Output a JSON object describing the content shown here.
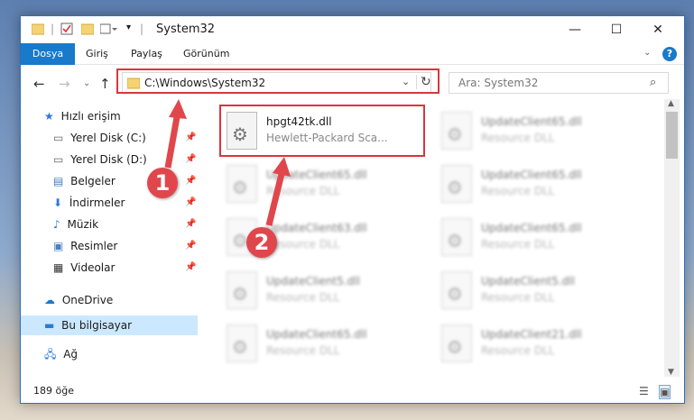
{
  "window": {
    "title": "System32"
  },
  "ribbon": {
    "tabs": [
      "Dosya",
      "Giriş",
      "Paylaş",
      "Görünüm"
    ]
  },
  "address": {
    "path": "C:\\Windows\\System32"
  },
  "search": {
    "placeholder": "Ara: System32"
  },
  "sidebar": {
    "quick_access": "Hızlı erişim",
    "items": [
      "Yerel Disk (C:)",
      "Yerel Disk (D:)",
      "Belgeler",
      "İndirmeler",
      "Müzik",
      "Resimler",
      "Videolar"
    ],
    "onedrive": "OneDrive",
    "this_pc": "Bu bilgisayar",
    "network": "Ağ"
  },
  "files": [
    {
      "name": "hpgt42tk.dll",
      "desc": "Hewlett-Packard Sca..."
    },
    {
      "name": "UpdateClient65.dll",
      "desc": "Resource DLL"
    },
    {
      "name": "UpdateClient65.dll",
      "desc": "Resource DLL"
    },
    {
      "name": "UpdateClient65.dll",
      "desc": "Resource DLL"
    },
    {
      "name": "UpdateClient63.dll",
      "desc": "Resource DLL"
    },
    {
      "name": "UpdateClient65.dll",
      "desc": "Resource DLL"
    },
    {
      "name": "UpdateClient5.dll",
      "desc": "Resource DLL"
    },
    {
      "name": "UpdateClient5.dll",
      "desc": "Resource DLL"
    },
    {
      "name": "UpdateClient65.dll",
      "desc": "Resource DLL"
    },
    {
      "name": "UpdateClient21.dll",
      "desc": "Resource DLL"
    }
  ],
  "status": {
    "count": "189 öğe"
  },
  "annotations": {
    "badge1": "1",
    "badge2": "2"
  },
  "colors": {
    "accent": "#1979ca",
    "highlight": "#d9363e",
    "badge": "#e0474c",
    "selection": "#cce8ff"
  }
}
